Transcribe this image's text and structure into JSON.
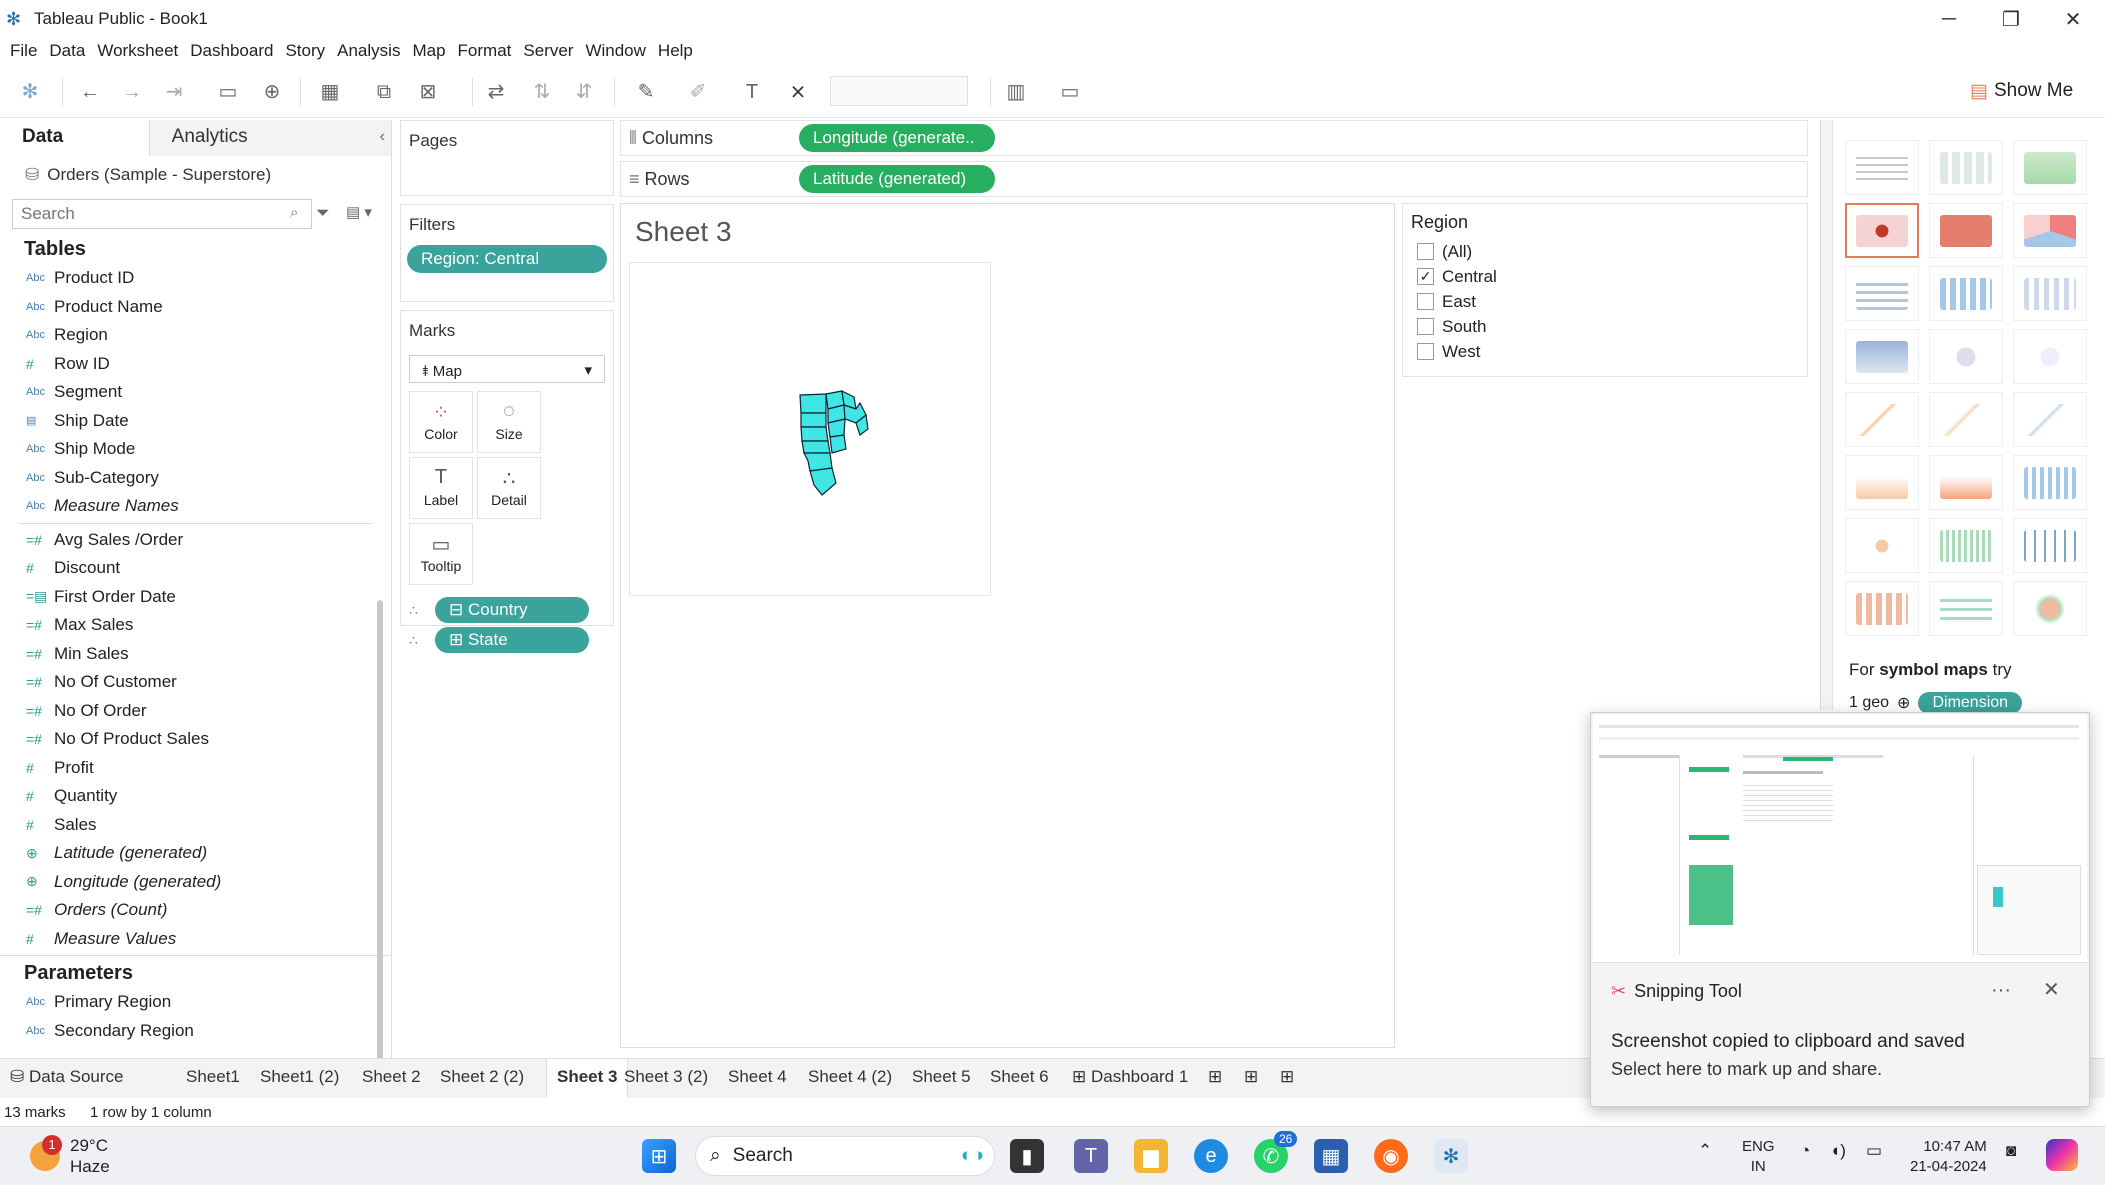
{
  "window": {
    "title": "Tableau Public - Book1"
  },
  "menu": [
    "File",
    "Data",
    "Worksheet",
    "Dashboard",
    "Story",
    "Analysis",
    "Map",
    "Format",
    "Server",
    "Window",
    "Help"
  ],
  "toolbar": {
    "show_me": "Show Me"
  },
  "data_pane": {
    "tab_data": "Data",
    "tab_analytics": "Analytics",
    "datasource": "Orders (Sample - Superstore)",
    "search_placeholder": "Search",
    "tables_title": "Tables",
    "dimensions": [
      {
        "type": "Abc",
        "name": "Product ID",
        "italic": false
      },
      {
        "type": "Abc",
        "name": "Product Name",
        "italic": false
      },
      {
        "type": "Abc",
        "name": "Region",
        "italic": false
      },
      {
        "type": "#",
        "name": "Row ID",
        "italic": false
      },
      {
        "type": "Abc",
        "name": "Segment",
        "italic": false
      },
      {
        "type": "date",
        "name": "Ship Date",
        "italic": false
      },
      {
        "type": "Abc",
        "name": "Ship Mode",
        "italic": false
      },
      {
        "type": "Abc",
        "name": "Sub-Category",
        "italic": false
      },
      {
        "type": "Abc",
        "name": "Measure Names",
        "italic": true
      }
    ],
    "measures": [
      {
        "type": "=#",
        "name": "Avg Sales /Order",
        "italic": false
      },
      {
        "type": "#",
        "name": "Discount",
        "italic": false
      },
      {
        "type": "=date",
        "name": "First Order Date",
        "italic": false
      },
      {
        "type": "=#",
        "name": "Max Sales",
        "italic": false
      },
      {
        "type": "=#",
        "name": "Min Sales",
        "italic": false
      },
      {
        "type": "=#",
        "name": "No Of Customer",
        "italic": false
      },
      {
        "type": "=#",
        "name": "No Of Order",
        "italic": false
      },
      {
        "type": "=#",
        "name": "No Of Product Sales",
        "italic": false
      },
      {
        "type": "#",
        "name": "Profit",
        "italic": false
      },
      {
        "type": "#",
        "name": "Quantity",
        "italic": false
      },
      {
        "type": "#",
        "name": "Sales",
        "italic": false
      },
      {
        "type": "geo",
        "name": "Latitude (generated)",
        "italic": true
      },
      {
        "type": "geo",
        "name": "Longitude (generated)",
        "italic": true
      },
      {
        "type": "=#",
        "name": "Orders (Count)",
        "italic": true
      },
      {
        "type": "#",
        "name": "Measure Values",
        "italic": true
      }
    ],
    "parameters_title": "Parameters",
    "parameters": [
      {
        "type": "Abc",
        "name": "Primary Region"
      },
      {
        "type": "Abc",
        "name": "Secondary Region"
      }
    ]
  },
  "pages": {
    "title": "Pages"
  },
  "filters": {
    "title": "Filters",
    "pill": "Region: Central"
  },
  "marks": {
    "title": "Marks",
    "type": "Map",
    "buttons": [
      {
        "label": "Color",
        "icon": "color-icon"
      },
      {
        "label": "Size",
        "icon": "size-icon"
      },
      {
        "label": "Label",
        "icon": "label-icon"
      },
      {
        "label": "Detail",
        "icon": "detail-icon"
      },
      {
        "label": "Tooltip",
        "icon": "tooltip-icon"
      }
    ],
    "pills": [
      "Country",
      "State"
    ]
  },
  "shelves": {
    "columns_label": "Columns",
    "columns_pill": "Longitude (generate..",
    "rows_label": "Rows",
    "rows_pill": "Latitude (generated)"
  },
  "sheet": {
    "title": "Sheet 3"
  },
  "region_filter": {
    "title": "Region",
    "options": [
      {
        "label": "(All)",
        "checked": false
      },
      {
        "label": "Central",
        "checked": true
      },
      {
        "label": "East",
        "checked": false
      },
      {
        "label": "South",
        "checked": false
      },
      {
        "label": "West",
        "checked": false
      }
    ]
  },
  "show_me_panel": {
    "hint_prefix": "For ",
    "hint_bold": "symbol maps",
    "hint_suffix": " try",
    "geo_label": "1 geo",
    "dimension_pill": "Dimension"
  },
  "sheet_tabs": {
    "data_source": "Data Source",
    "tabs": [
      "Sheet1",
      "Sheet1 (2)",
      "Sheet 2",
      "Sheet 2 (2)",
      "Sheet 3",
      "Sheet 3 (2)",
      "Sheet 4",
      "Sheet 4 (2)",
      "Sheet 5",
      "Sheet 6",
      "Dashboard 1"
    ],
    "active": "Sheet 3"
  },
  "status": {
    "marks": "13 marks",
    "dims": "1 row by 1 column"
  },
  "toast": {
    "app": "Snipping Tool",
    "message": "Screenshot copied to clipboard and saved",
    "sub": "Select here to mark up and share."
  },
  "taskbar": {
    "temp": "29°C",
    "weather": "Haze",
    "weather_badge": "1",
    "search": "Search",
    "whatsapp_badge": "26",
    "lang1": "ENG",
    "lang2": "IN",
    "time": "10:47 AM",
    "date": "21-04-2024"
  },
  "colors": {
    "pill_teal": "#3aa39c",
    "pill_green": "#27ae60",
    "map_fill": "#3ee6e6",
    "accent_orange": "#e47d57"
  }
}
